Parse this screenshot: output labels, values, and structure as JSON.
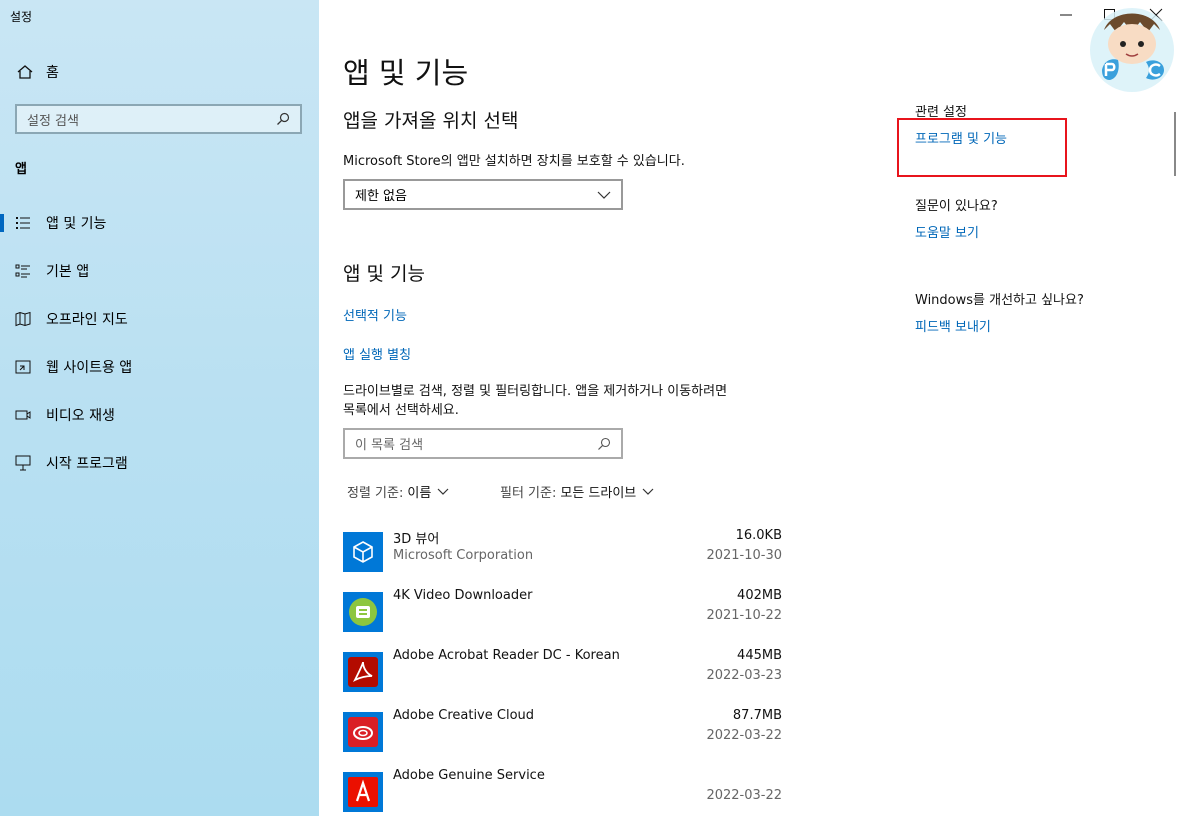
{
  "window": {
    "title": "설정"
  },
  "sidebar": {
    "home_label": "홈",
    "search_placeholder": "설정 검색",
    "section_label": "앱",
    "items": [
      {
        "label": "앱 및 기능",
        "icon": "apps-features-icon",
        "active": true
      },
      {
        "label": "기본 앱",
        "icon": "default-apps-icon"
      },
      {
        "label": "오프라인 지도",
        "icon": "offline-maps-icon"
      },
      {
        "label": "웹 사이트용 앱",
        "icon": "apps-websites-icon"
      },
      {
        "label": "비디오 재생",
        "icon": "video-playback-icon"
      },
      {
        "label": "시작 프로그램",
        "icon": "startup-icon"
      }
    ]
  },
  "main": {
    "title": "앱 및 기능",
    "install_heading": "앱을 가져올 위치 선택",
    "install_desc": "Microsoft Store의 앱만 설치하면 장치를 보호할 수 있습니다.",
    "install_dropdown_value": "제한 없음",
    "apps_heading": "앱 및 기능",
    "link_optional": "선택적 기능",
    "link_aliases": "앱 실행 별칭",
    "filter_desc_line1": "드라이브별로 검색, 정렬 및 필터링합니다. 앱을 제거하거나 이동하려면",
    "filter_desc_line2": "목록에서 선택하세요.",
    "app_search_placeholder": "이 목록 검색",
    "sort_key": "정렬 기준:",
    "sort_value": "이름",
    "filter_key": "필터 기준:",
    "filter_value": "모든 드라이브",
    "apps": [
      {
        "name": "3D 뷰어",
        "publisher": "Microsoft Corporation",
        "size": "16.0KB",
        "date": "2021-10-30",
        "icon": "3d-viewer-icon",
        "color": "#0078d7"
      },
      {
        "name": "4K Video Downloader",
        "publisher": "",
        "size": "402MB",
        "date": "2021-10-22",
        "icon": "4k-video-downloader-icon",
        "color": "#0078d7"
      },
      {
        "name": "Adobe Acrobat Reader DC - Korean",
        "publisher": "",
        "size": "445MB",
        "date": "2022-03-23",
        "icon": "acrobat-reader-icon",
        "color": "#0078d7"
      },
      {
        "name": "Adobe Creative Cloud",
        "publisher": "",
        "size": "87.7MB",
        "date": "2022-03-22",
        "icon": "creative-cloud-icon",
        "color": "#0078d7"
      },
      {
        "name": "Adobe Genuine Service",
        "publisher": "",
        "size": "",
        "date": "2022-03-22",
        "icon": "adobe-genuine-icon",
        "color": "#0078d7"
      }
    ]
  },
  "related": {
    "heading": "관련 설정",
    "programs_link": "프로그램 및 기능",
    "question_heading": "질문이 있나요?",
    "help_link": "도움말 보기",
    "improve_heading": "Windows를 개선하고 싶나요?",
    "feedback_link": "피드백 보내기"
  },
  "colors": {
    "accent": "#0067b8",
    "highlight_box": "#e8141c",
    "sidebar_bg": "#bfe3f3"
  }
}
